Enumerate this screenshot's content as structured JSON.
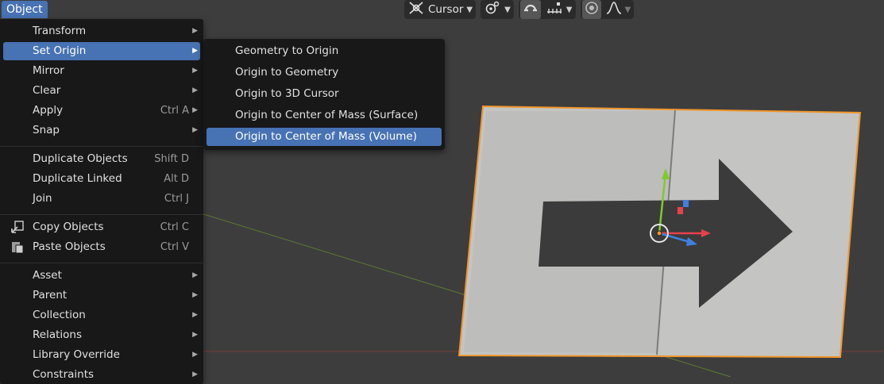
{
  "header": {
    "object_menu": "Object"
  },
  "toolbar": {
    "pivot_label": "Cursor",
    "pivot_icon": "transform-pivot-icon",
    "snap_icon": "snap-icon",
    "increment_icon": "snap-increment-icon",
    "proportional_icon": "proportional-editing-icon",
    "falloff_icon": "falloff-curve-icon"
  },
  "object_menu": {
    "items": [
      {
        "label": "Transform",
        "shortcut": "",
        "submenu": true
      },
      {
        "label": "Set Origin",
        "shortcut": "",
        "submenu": true,
        "highlighted": true
      },
      {
        "label": "Mirror",
        "shortcut": "",
        "submenu": true
      },
      {
        "label": "Clear",
        "shortcut": "",
        "submenu": true
      },
      {
        "label": "Apply",
        "shortcut": "Ctrl A",
        "submenu": true
      },
      {
        "label": "Snap",
        "shortcut": "",
        "submenu": true
      },
      {
        "label": "Duplicate Objects",
        "shortcut": "Shift D",
        "submenu": false
      },
      {
        "label": "Duplicate Linked",
        "shortcut": "Alt D",
        "submenu": false
      },
      {
        "label": "Join",
        "shortcut": "Ctrl J",
        "submenu": false
      },
      {
        "label": "Copy Objects",
        "shortcut": "Ctrl C",
        "submenu": false,
        "icon": "copy-icon"
      },
      {
        "label": "Paste Objects",
        "shortcut": "Ctrl V",
        "submenu": false,
        "icon": "paste-icon"
      },
      {
        "label": "Asset",
        "shortcut": "",
        "submenu": true
      },
      {
        "label": "Parent",
        "shortcut": "",
        "submenu": true
      },
      {
        "label": "Collection",
        "shortcut": "",
        "submenu": true
      },
      {
        "label": "Relations",
        "shortcut": "",
        "submenu": true
      },
      {
        "label": "Library Override",
        "shortcut": "",
        "submenu": true
      },
      {
        "label": "Constraints",
        "shortcut": "",
        "submenu": true
      }
    ]
  },
  "set_origin_menu": {
    "items": [
      {
        "label": "Geometry to Origin"
      },
      {
        "label": "Origin to Geometry"
      },
      {
        "label": "Origin to 3D Cursor"
      },
      {
        "label": "Origin to Center of Mass (Surface)"
      },
      {
        "label": "Origin to Center of Mass (Volume)",
        "highlighted": true
      }
    ]
  },
  "colors": {
    "accent": "#4772b3",
    "menu_bg": "#181818",
    "viewport_bg": "#3d3d3d",
    "selection_outline": "#f0962c",
    "axis_x": "#e8414a",
    "axis_y": "#7ecb2a",
    "axis_z": "#3f7fe0"
  }
}
